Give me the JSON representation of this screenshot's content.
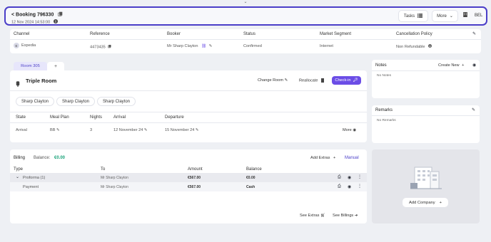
{
  "header": {
    "title": "< Booking 796330",
    "date": "12 Nov 2024 14:53:00",
    "tasks_label": "Tasks",
    "more_label": "More",
    "property_code": "BEL"
  },
  "summary": {
    "columns": [
      "Channel",
      "Reference",
      "Booker",
      "Status",
      "Market Segment",
      "Cancellation Policy"
    ],
    "channel_initial": "E",
    "channel": "Expedia",
    "reference": "4473435",
    "booker": "Mr Sharp Clayton",
    "status": "Confirmed",
    "market_segment": "Internet",
    "cancellation_policy": "Non Refundable"
  },
  "room": {
    "tab_label": "Room 305",
    "add_tab": "+",
    "room_type": "Triple Room",
    "change_room": "Change Room",
    "reallocate": "Reallocate",
    "check_in": "Check-in",
    "guests": [
      "Sharp Clayton",
      "Sharp Clayton",
      "Sharp Clayton"
    ],
    "columns": [
      "State",
      "Meal Plan",
      "Nights",
      "Arrival",
      "Departure"
    ],
    "state": "Arrival",
    "meal_plan": "BB",
    "nights": "3",
    "arrival": "12 November 24",
    "departure": "15 November 24",
    "more": "More"
  },
  "billing": {
    "title": "Billing",
    "balance_label": "Balance:",
    "balance_value": "€0.00",
    "add_extras": "Add Extras",
    "manual": "Manual",
    "columns": [
      "Type",
      "To",
      "Amount",
      "Balance"
    ],
    "rows": [
      {
        "type": "Proforma (1)",
        "to": "Mr Sharp Clayton",
        "amount": "€567.00",
        "balance": "€0.00"
      },
      {
        "type": "Payment",
        "to": "Mr Sharp Clayton",
        "amount": "€567.00",
        "balance": "Cash"
      }
    ],
    "see_extras": "See Extras",
    "see_billings": "See Billings"
  },
  "notes": {
    "title": "Notes",
    "create_new": "Create New",
    "empty": "No Notes"
  },
  "remarks": {
    "title": "Remarks",
    "empty": "No Remarks"
  },
  "company": {
    "add_company": "Add Company"
  },
  "colors": {
    "accent": "#6b4de6",
    "header_border": "#4a3ec8",
    "balance_green": "#1aa37a",
    "tab_bg": "#e7e6fb"
  }
}
